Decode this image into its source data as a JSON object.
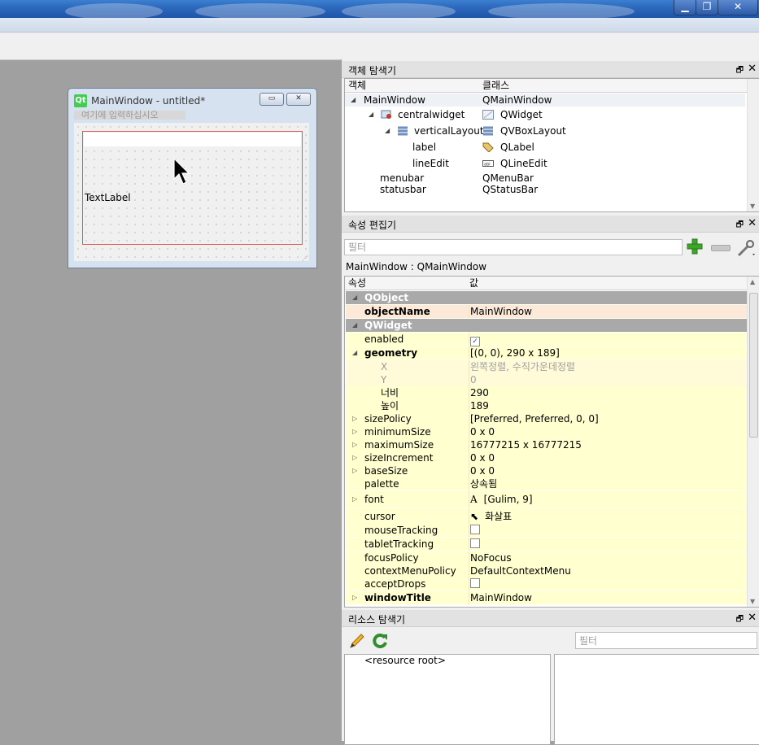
{
  "form_window": {
    "title": "MainWindow - untitled*",
    "menu_placeholder": "여기에 입력하십시오",
    "label_text": "TextLabel"
  },
  "object_inspector": {
    "title": "객체 탐색기",
    "col_object": "객체",
    "col_class": "클래스",
    "rows": [
      {
        "name": "MainWindow",
        "cls": "QMainWindow"
      },
      {
        "name": "centralwidget",
        "cls": "QWidget"
      },
      {
        "name": "verticalLayout",
        "cls": "QVBoxLayout"
      },
      {
        "name": "label",
        "cls": "QLabel"
      },
      {
        "name": "lineEdit",
        "cls": "QLineEdit"
      },
      {
        "name": "menubar",
        "cls": "QMenuBar"
      },
      {
        "name": "statusbar",
        "cls": "QStatusBar"
      }
    ]
  },
  "property_editor": {
    "title": "속성 편집기",
    "filter_placeholder": "필터",
    "context": "MainWindow : QMainWindow",
    "col_property": "속성",
    "col_value": "값",
    "rows": [
      {
        "name": "QObject",
        "value": ""
      },
      {
        "name": "objectName",
        "value": "MainWindow"
      },
      {
        "name": "QWidget",
        "value": ""
      },
      {
        "name": "enabled",
        "value": "✓"
      },
      {
        "name": "geometry",
        "value": "[(0, 0), 290 x 189]"
      },
      {
        "name": "X",
        "value": "왼쪽정렬, 수직가운데정렬"
      },
      {
        "name": "Y",
        "value": "0"
      },
      {
        "name": "너비",
        "value": "290"
      },
      {
        "name": "높이",
        "value": "189"
      },
      {
        "name": "sizePolicy",
        "value": "[Preferred, Preferred, 0, 0]"
      },
      {
        "name": "minimumSize",
        "value": "0 x 0"
      },
      {
        "name": "maximumSize",
        "value": "16777215 x 16777215"
      },
      {
        "name": "sizeIncrement",
        "value": "0 x 0"
      },
      {
        "name": "baseSize",
        "value": "0 x 0"
      },
      {
        "name": "palette",
        "value": "상속됨"
      },
      {
        "name": "font",
        "value": "[Gulim, 9]"
      },
      {
        "name": "cursor",
        "value": "화살표"
      },
      {
        "name": "mouseTracking",
        "value": ""
      },
      {
        "name": "tabletTracking",
        "value": ""
      },
      {
        "name": "focusPolicy",
        "value": "NoFocus"
      },
      {
        "name": "contextMenuPolicy",
        "value": "DefaultContextMenu"
      },
      {
        "name": "acceptDrops",
        "value": ""
      },
      {
        "name": "windowTitle",
        "value": "MainWindow"
      }
    ]
  },
  "resource_browser": {
    "title": "리소스 탐색기",
    "filter_placeholder": "필터",
    "root": "<resource root>"
  },
  "colors": {
    "section_bg": "#a9a9a9",
    "row_yellow": "#ffffcf",
    "row_selected": "#fde9d8",
    "layout_border": "#e05a5a"
  }
}
